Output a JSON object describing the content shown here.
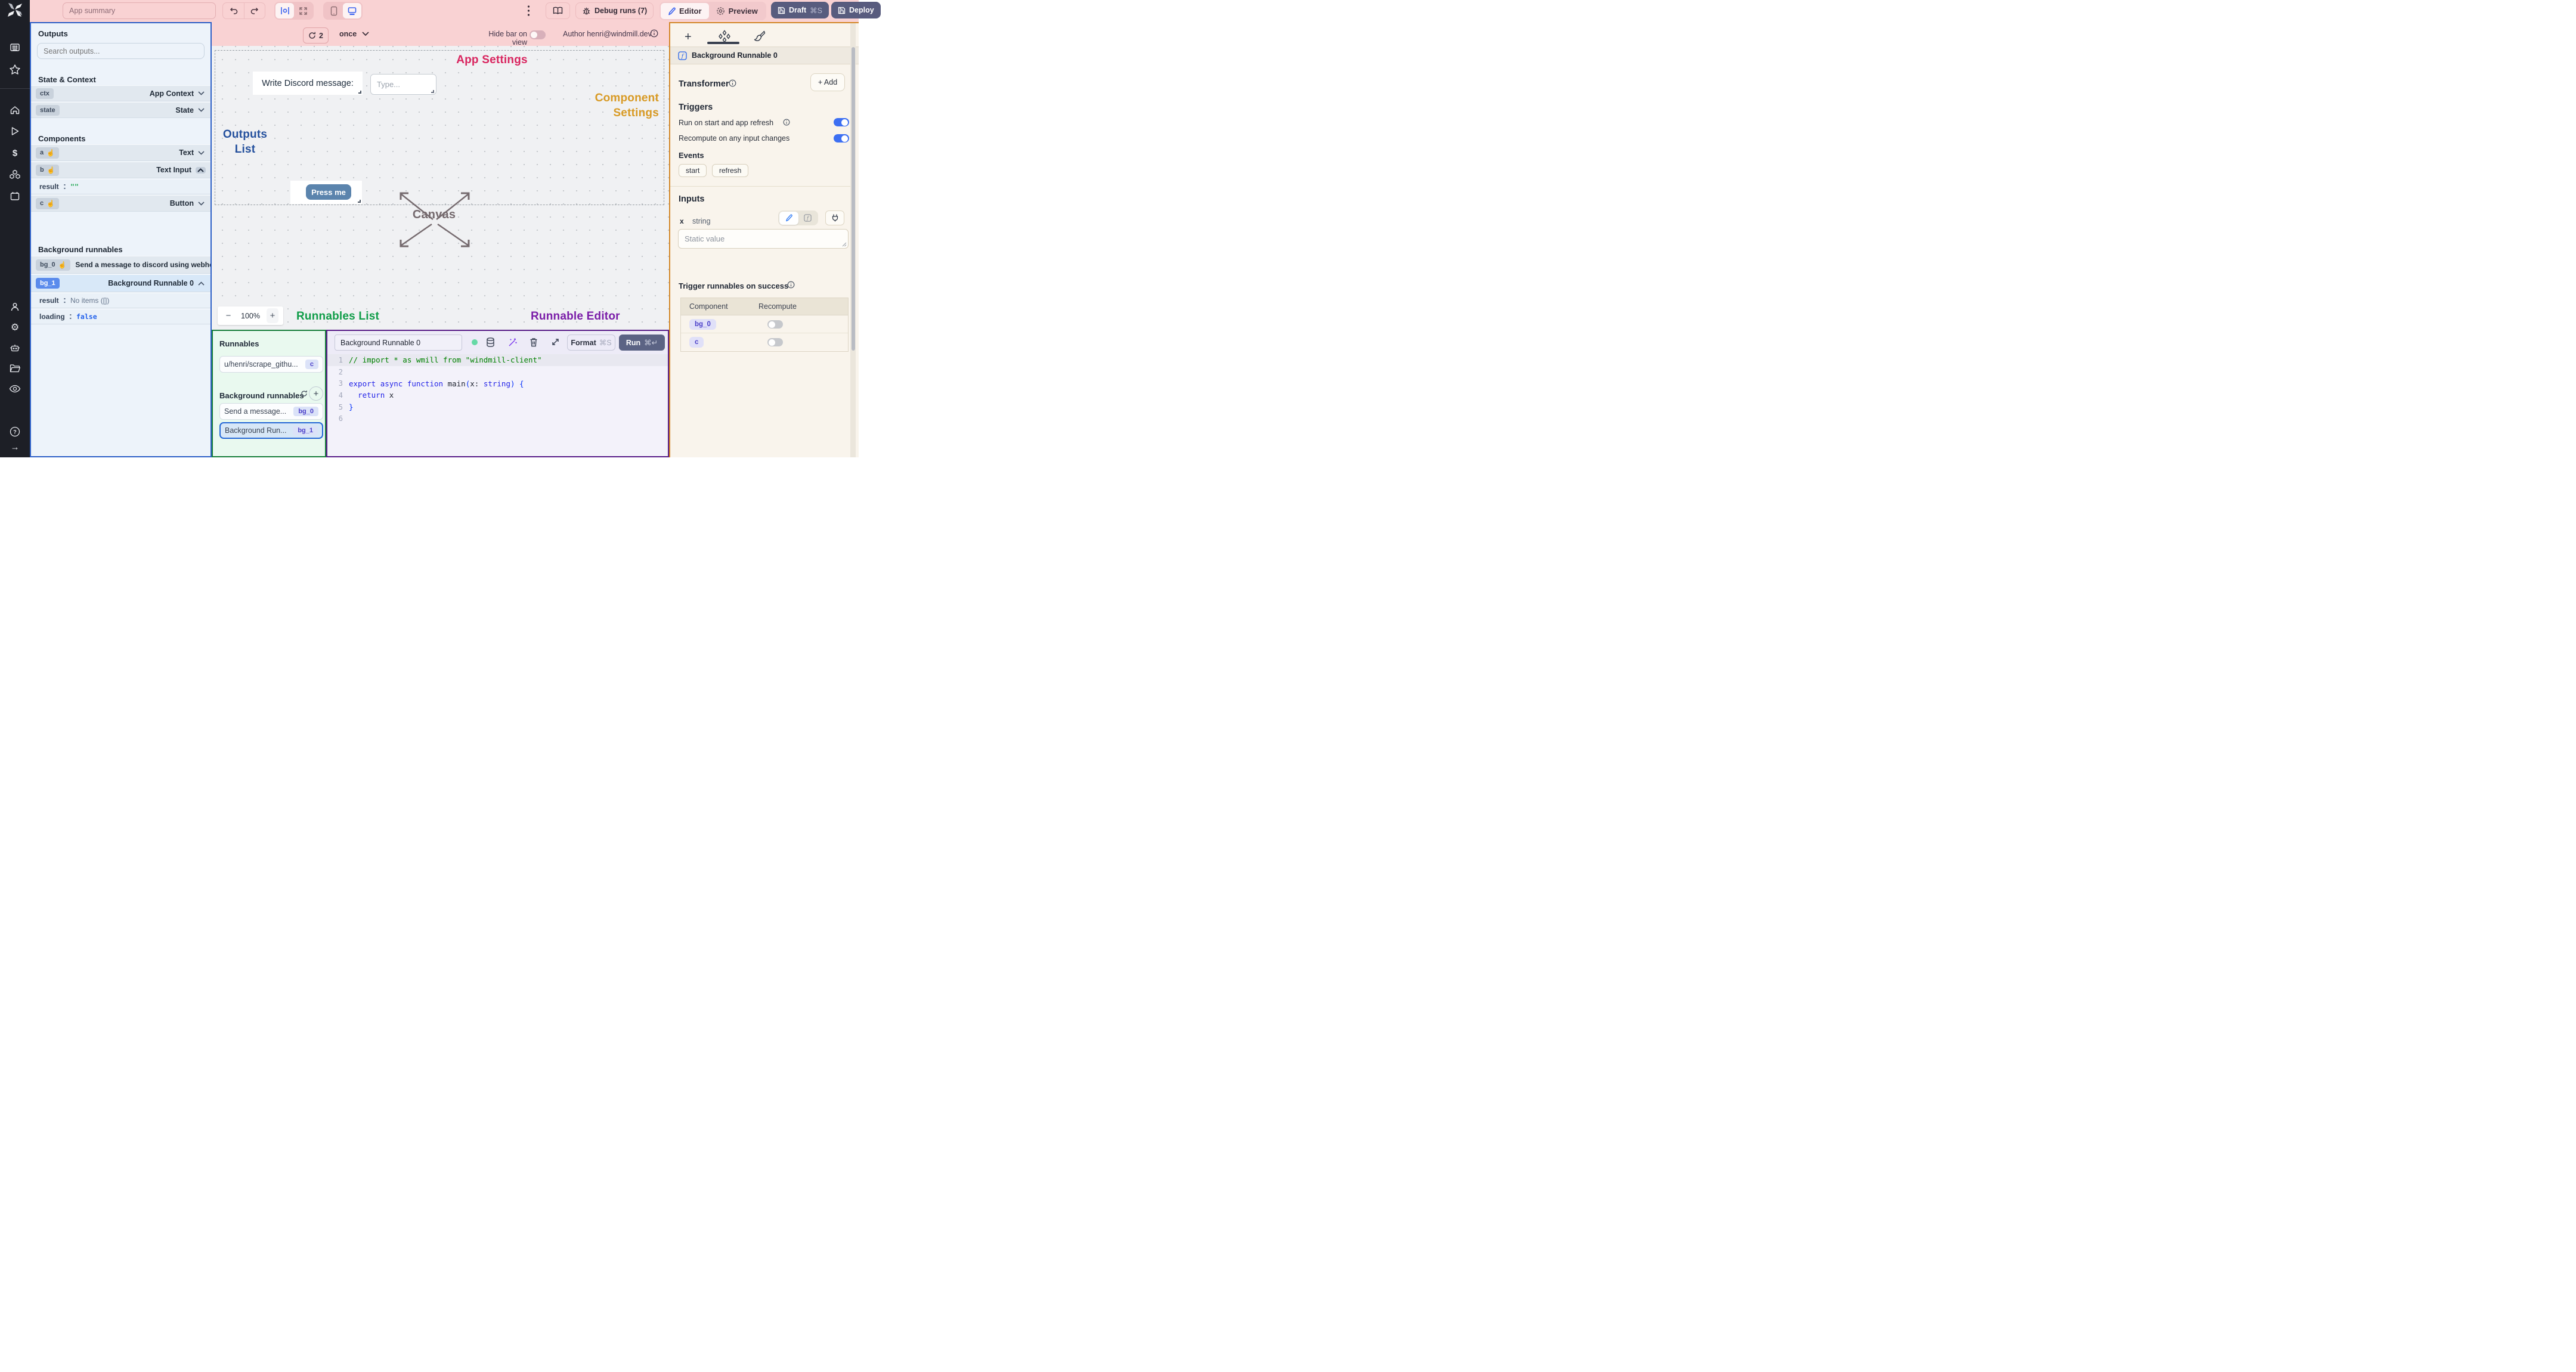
{
  "colors": {
    "accent_blue": "#3d6ff2",
    "pink": "#f9d2d3",
    "green_border": "#177e3b",
    "purple_border": "#571c87",
    "orange_border": "#d3882a",
    "outputs_border": "#2d5fc7"
  },
  "topbar": {
    "app_summary_placeholder": "App summary",
    "debug_runs": "Debug runs (7)",
    "editor": "Editor",
    "preview": "Preview",
    "draft": "Draft",
    "draft_shortcut": "⌘S",
    "deploy": "Deploy"
  },
  "canvas_bar": {
    "refresh_count": "2",
    "mode": "once",
    "hide_bar": "Hide bar on view",
    "author": "Author henri@windmill.dev"
  },
  "outputs": {
    "title": "Outputs",
    "search_placeholder": "Search outputs...",
    "state_context_title": "State & Context",
    "ctx_id": "ctx",
    "ctx_type": "App Context",
    "state_id": "state",
    "state_type": "State",
    "components_title": "Components",
    "a_id": "a",
    "a_type": "Text",
    "b_id": "b",
    "b_type": "Text Input",
    "b_result_key": "result",
    "b_result_value": "\"\"",
    "c_id": "c",
    "c_type": "Button",
    "bg_title": "Background runnables",
    "bg0_id": "bg_0",
    "bg0_label": "Send a message to discord using webhoo",
    "bg1_id": "bg_1",
    "bg1_label": "Background Runnable 0",
    "bg1_result_key": "result",
    "bg1_result_value": "No items ([])",
    "bg1_loading_key": "loading",
    "bg1_loading_value": "false"
  },
  "canvas": {
    "app_settings": "App Settings",
    "component_settings_1": "Component",
    "component_settings_2": "Settings",
    "outputs_list_1": "Outputs",
    "outputs_list_2": "List",
    "canvas_label": "Canvas",
    "discord_label": "Write Discord message:",
    "type_placeholder": "Type...",
    "press_me": "Press me",
    "zoom_out": "−",
    "zoom_level": "100%",
    "zoom_in": "+",
    "runnables_list": "Runnables List",
    "runnable_editor": "Runnable Editor"
  },
  "runnables": {
    "title": "Runnables",
    "item1_label": "u/henri/scrape_githu...",
    "item1_badge": "c",
    "bg_title": "Background runnables",
    "item2_label": "Send a message...",
    "item2_badge": "bg_0",
    "item3_label": "Background Run...",
    "item3_badge": "bg_1"
  },
  "editor": {
    "name": "Background Runnable 0",
    "format": "Format",
    "format_shortcut": "⌘S",
    "run": "Run",
    "run_shortcut": "⌘↵",
    "lines": [
      "1",
      "2",
      "3",
      "4",
      "5",
      "6"
    ],
    "code": [
      [
        {
          "t": "// import * as wmill from \"windmill-client\"",
          "c": "com"
        }
      ],
      [],
      [
        {
          "t": "export",
          "c": "kw"
        },
        {
          "t": " ",
          "c": "pl"
        },
        {
          "t": "async",
          "c": "kw"
        },
        {
          "t": " ",
          "c": "pl"
        },
        {
          "t": "function",
          "c": "kw"
        },
        {
          "t": " main",
          "c": "pl"
        },
        {
          "t": "(",
          "c": "br"
        },
        {
          "t": "x: ",
          "c": "pl"
        },
        {
          "t": "string",
          "c": "kw"
        },
        {
          "t": ")",
          "c": "br"
        },
        {
          "t": " ",
          "c": "pl"
        },
        {
          "t": "{",
          "c": "br"
        }
      ],
      [
        {
          "t": "  ",
          "c": "pl"
        },
        {
          "t": "return",
          "c": "kw"
        },
        {
          "t": " x",
          "c": "pl"
        }
      ],
      [
        {
          "t": "}",
          "c": "br"
        }
      ],
      []
    ]
  },
  "right": {
    "header": "Background Runnable 0",
    "transformer": "Transformer",
    "add": "+ Add",
    "triggers": "Triggers",
    "row1": "Run on start and app refresh",
    "row2": "Recompute on any input changes",
    "events": "Events",
    "chip1": "start",
    "chip2": "refresh",
    "inputs": "Inputs",
    "x": "x",
    "x_type": "string",
    "static_placeholder": "Static value",
    "trigger_title": "Trigger runnables on success",
    "col1": "Component",
    "col2": "Recompute",
    "row_a": "bg_0",
    "row_b": "c"
  }
}
